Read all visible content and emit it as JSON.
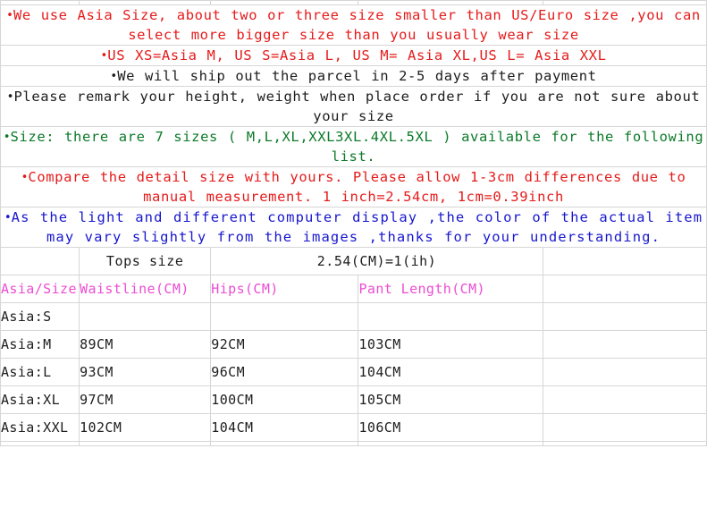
{
  "notices": [
    {
      "id": "asia-size-note",
      "color": "red",
      "bullet": "•",
      "text": "We use Asia Size, about two or three size smaller than US/Euro size ,you can select more bigger size than you usually wear size"
    },
    {
      "id": "us-asia-conversion-note",
      "color": "red",
      "bullet": "•",
      "text": "US XS=Asia M, US S=Asia L, US M= Asia XL,US L= Asia XXL"
    },
    {
      "id": "shipping-note",
      "color": "black",
      "bullet": "•",
      "text": "We will ship out the parcel in 2-5 days after payment"
    },
    {
      "id": "remark-measurements-note",
      "color": "black",
      "bullet": "•",
      "text": "Please remark your height, weight when place order if you are not sure about your size"
    },
    {
      "id": "available-sizes-note",
      "color": "green",
      "bullet": "•",
      "text": "Size: there are 7 sizes ( M,L,XL,XXL3XL.4XL.5XL ) available for the following list."
    },
    {
      "id": "measurement-tolerance-note",
      "color": "red",
      "bullet": "•",
      "text": "Compare the detail size with yours. Please allow 1-3cm differences due to manual measurement. 1 inch=2.54cm, 1cm=0.39inch"
    },
    {
      "id": "color-display-note",
      "color": "blue",
      "bullet": "•",
      "text": "As the light and different computer display ,the color of the actual item may vary slightly from the images ,thanks for your understanding."
    }
  ],
  "size_table": {
    "title_row": {
      "label": "Tops size",
      "conversion": "2.54(CM)=1(ih)"
    },
    "columns": [
      "Asia/Size",
      "Waistline(CM)",
      "Hips(CM)",
      "Pant Length(CM)"
    ],
    "rows": [
      {
        "size": "Asia:S",
        "waistline": "",
        "hips": "",
        "pant_length": ""
      },
      {
        "size": "Asia:M",
        "waistline": "89CM",
        "hips": "92CM",
        "pant_length": "103CM"
      },
      {
        "size": "Asia:L",
        "waistline": "93CM",
        "hips": "96CM",
        "pant_length": "104CM"
      },
      {
        "size": "Asia:XL",
        "waistline": "97CM",
        "hips": "100CM",
        "pant_length": "105CM"
      },
      {
        "size": "Asia:XXL",
        "waistline": "102CM",
        "hips": "104CM",
        "pant_length": "106CM"
      }
    ]
  },
  "colors": {
    "red": "#e51b1b",
    "black": "#1d1d1d",
    "green": "#0b7a28",
    "blue": "#1717cf",
    "pink": "#ec4cd2",
    "grid": "#d6d6d6",
    "background": "#ffffff"
  }
}
